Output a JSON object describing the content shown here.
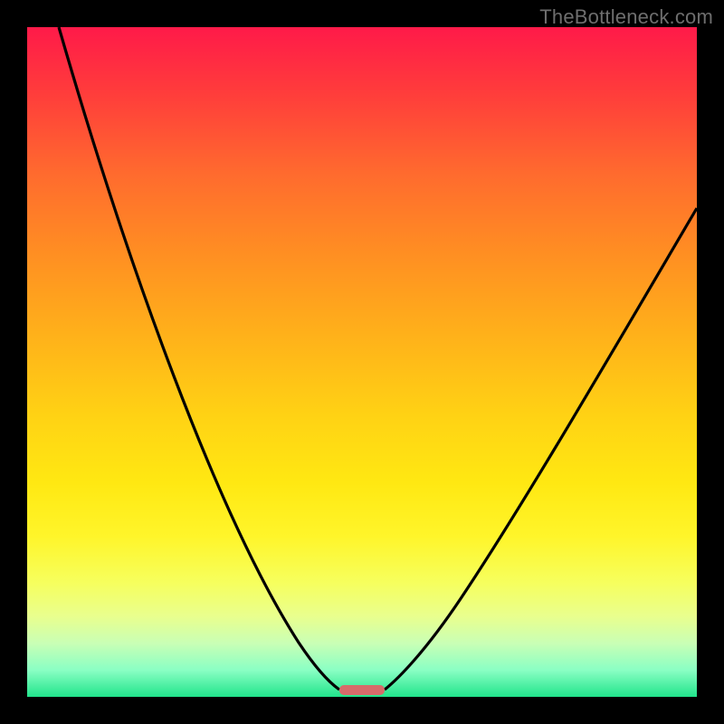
{
  "watermark": "TheBottleneck.com",
  "chart_data": {
    "type": "line",
    "title": "",
    "xlabel": "",
    "ylabel": "",
    "xlim": [
      0,
      100
    ],
    "ylim": [
      0,
      100
    ],
    "gradient_stops": [
      {
        "pos": 0,
        "color": "#ff1a49"
      },
      {
        "pos": 10,
        "color": "#ff3d3b"
      },
      {
        "pos": 22,
        "color": "#ff6b2e"
      },
      {
        "pos": 34,
        "color": "#ff8f22"
      },
      {
        "pos": 46,
        "color": "#ffb11a"
      },
      {
        "pos": 58,
        "color": "#ffd214"
      },
      {
        "pos": 68,
        "color": "#ffe812"
      },
      {
        "pos": 76,
        "color": "#fff52a"
      },
      {
        "pos": 83,
        "color": "#f6ff5e"
      },
      {
        "pos": 88,
        "color": "#e9ff8e"
      },
      {
        "pos": 92,
        "color": "#c9ffb5"
      },
      {
        "pos": 96,
        "color": "#8affc4"
      },
      {
        "pos": 100,
        "color": "#21e48b"
      }
    ],
    "series": [
      {
        "name": "left-curve",
        "x": [
          5,
          12,
          20,
          28,
          35,
          40,
          44,
          46.5
        ],
        "y": [
          100,
          72,
          48,
          28,
          14,
          6,
          2,
          0.8
        ]
      },
      {
        "name": "right-curve",
        "x": [
          53.5,
          57,
          62,
          70,
          80,
          90,
          100
        ],
        "y": [
          0.8,
          3,
          8,
          20,
          40,
          58,
          73
        ]
      }
    ],
    "marker": {
      "x_center_pct": 50,
      "width_pct": 7,
      "style": "left:345px; width:50px; bottom:2px;"
    }
  }
}
